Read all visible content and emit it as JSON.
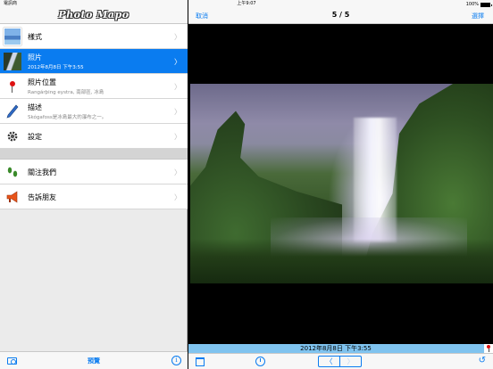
{
  "status_bar": {
    "carrier": "電訊商 ",
    "time": "上午9:07",
    "battery_percent": "100%"
  },
  "left_panel": {
    "logo_text": "Photo Mapo",
    "menu": [
      {
        "label": "樣式",
        "subtitle": "",
        "icon": "template-thumbnail-icon"
      },
      {
        "label": "照片",
        "subtitle": "2012年8月8日 下午3:55",
        "icon": "photo-thumbnail-icon",
        "selected": true
      },
      {
        "label": "照片位置",
        "subtitle": "Rangárþing eystra, 南部區, 冰島",
        "icon": "map-pin-icon"
      },
      {
        "label": "描述",
        "subtitle": "Skógafoss是冰島最大的瀑布之一。",
        "icon": "pen-icon"
      },
      {
        "label": "設定",
        "subtitle": "",
        "icon": "gear-icon"
      }
    ],
    "menu2": [
      {
        "label": "關注我們",
        "icon": "footprints-icon"
      },
      {
        "label": "告訴朋友",
        "icon": "megaphone-icon"
      }
    ],
    "toolbar": {
      "preview_label": "預覽",
      "info_label": "i"
    }
  },
  "right_panel": {
    "nav": {
      "cancel_label": "取消",
      "title": "5 / 5",
      "choose_label": "選擇"
    },
    "caption": "2012年8月8日 下午3:55",
    "toolbar": {
      "prev_label": "〈",
      "next_label": "〉",
      "undo_label": "↺"
    }
  },
  "colors": {
    "accent": "#0a7cf0",
    "selected_row": "#0a7cf0",
    "caption_bar": "#7fc3ef"
  }
}
